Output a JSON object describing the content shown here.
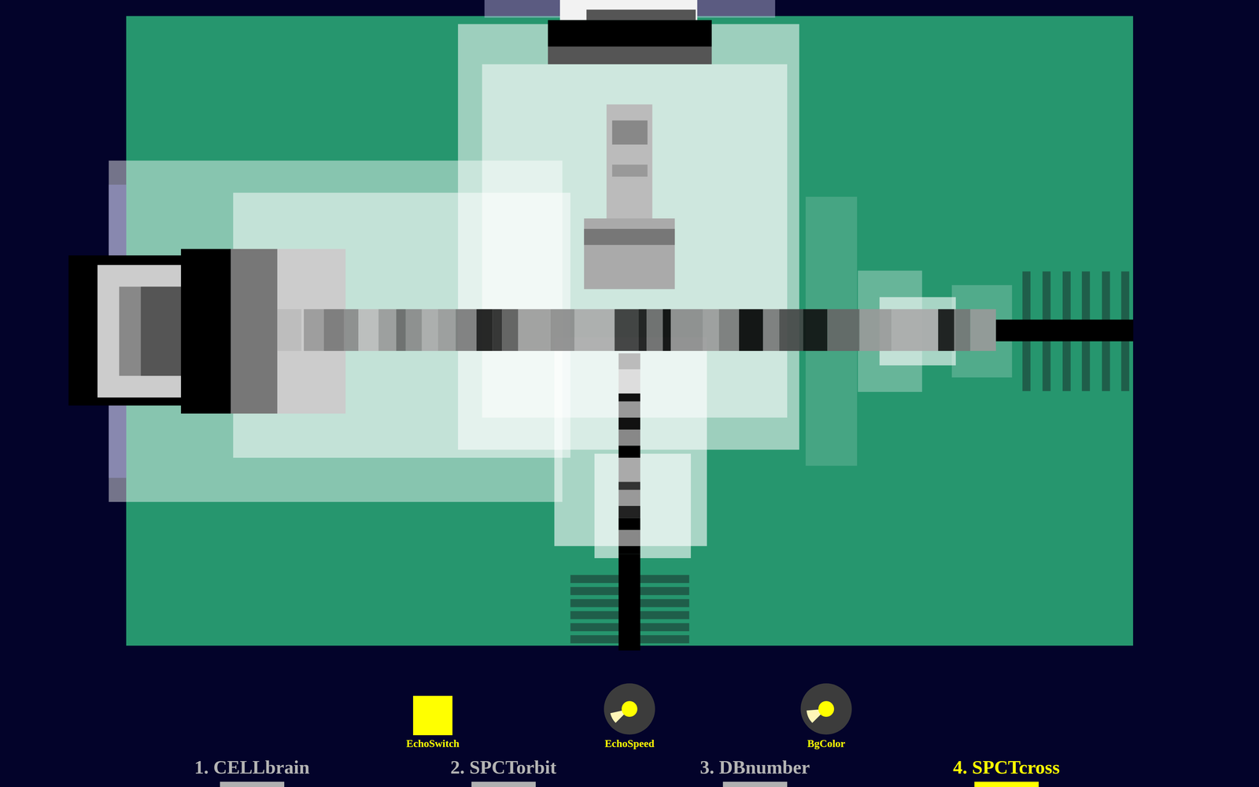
{
  "visualizer": {
    "title": "SPCTcross"
  },
  "controls": [
    {
      "label": "EchoSwitch",
      "kind": "switch",
      "on": true
    },
    {
      "label": "EchoSpeed",
      "kind": "knob",
      "level": 0.12
    },
    {
      "label": "BgColor",
      "kind": "knob",
      "level": 0.15
    }
  ],
  "tabs": [
    {
      "label": "1. CELLbrain",
      "selected": false
    },
    {
      "label": "2. SPCTorbit",
      "selected": false
    },
    {
      "label": "3. DBnumber",
      "selected": false
    },
    {
      "label": "4. SPCTcross",
      "selected": true
    }
  ]
}
